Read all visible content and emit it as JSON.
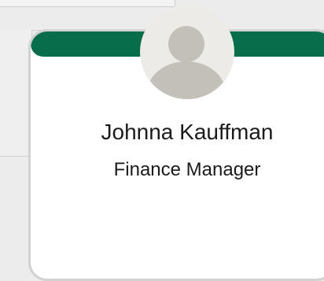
{
  "profile": {
    "name": "Johnna Kauffman",
    "title": "Finance Manager"
  },
  "theme": {
    "header_color": "#076d4a",
    "avatar_background": "#edebe7",
    "avatar_silhouette": "#c3c0ba"
  },
  "icons": {
    "avatar": "user-silhouette-icon"
  }
}
